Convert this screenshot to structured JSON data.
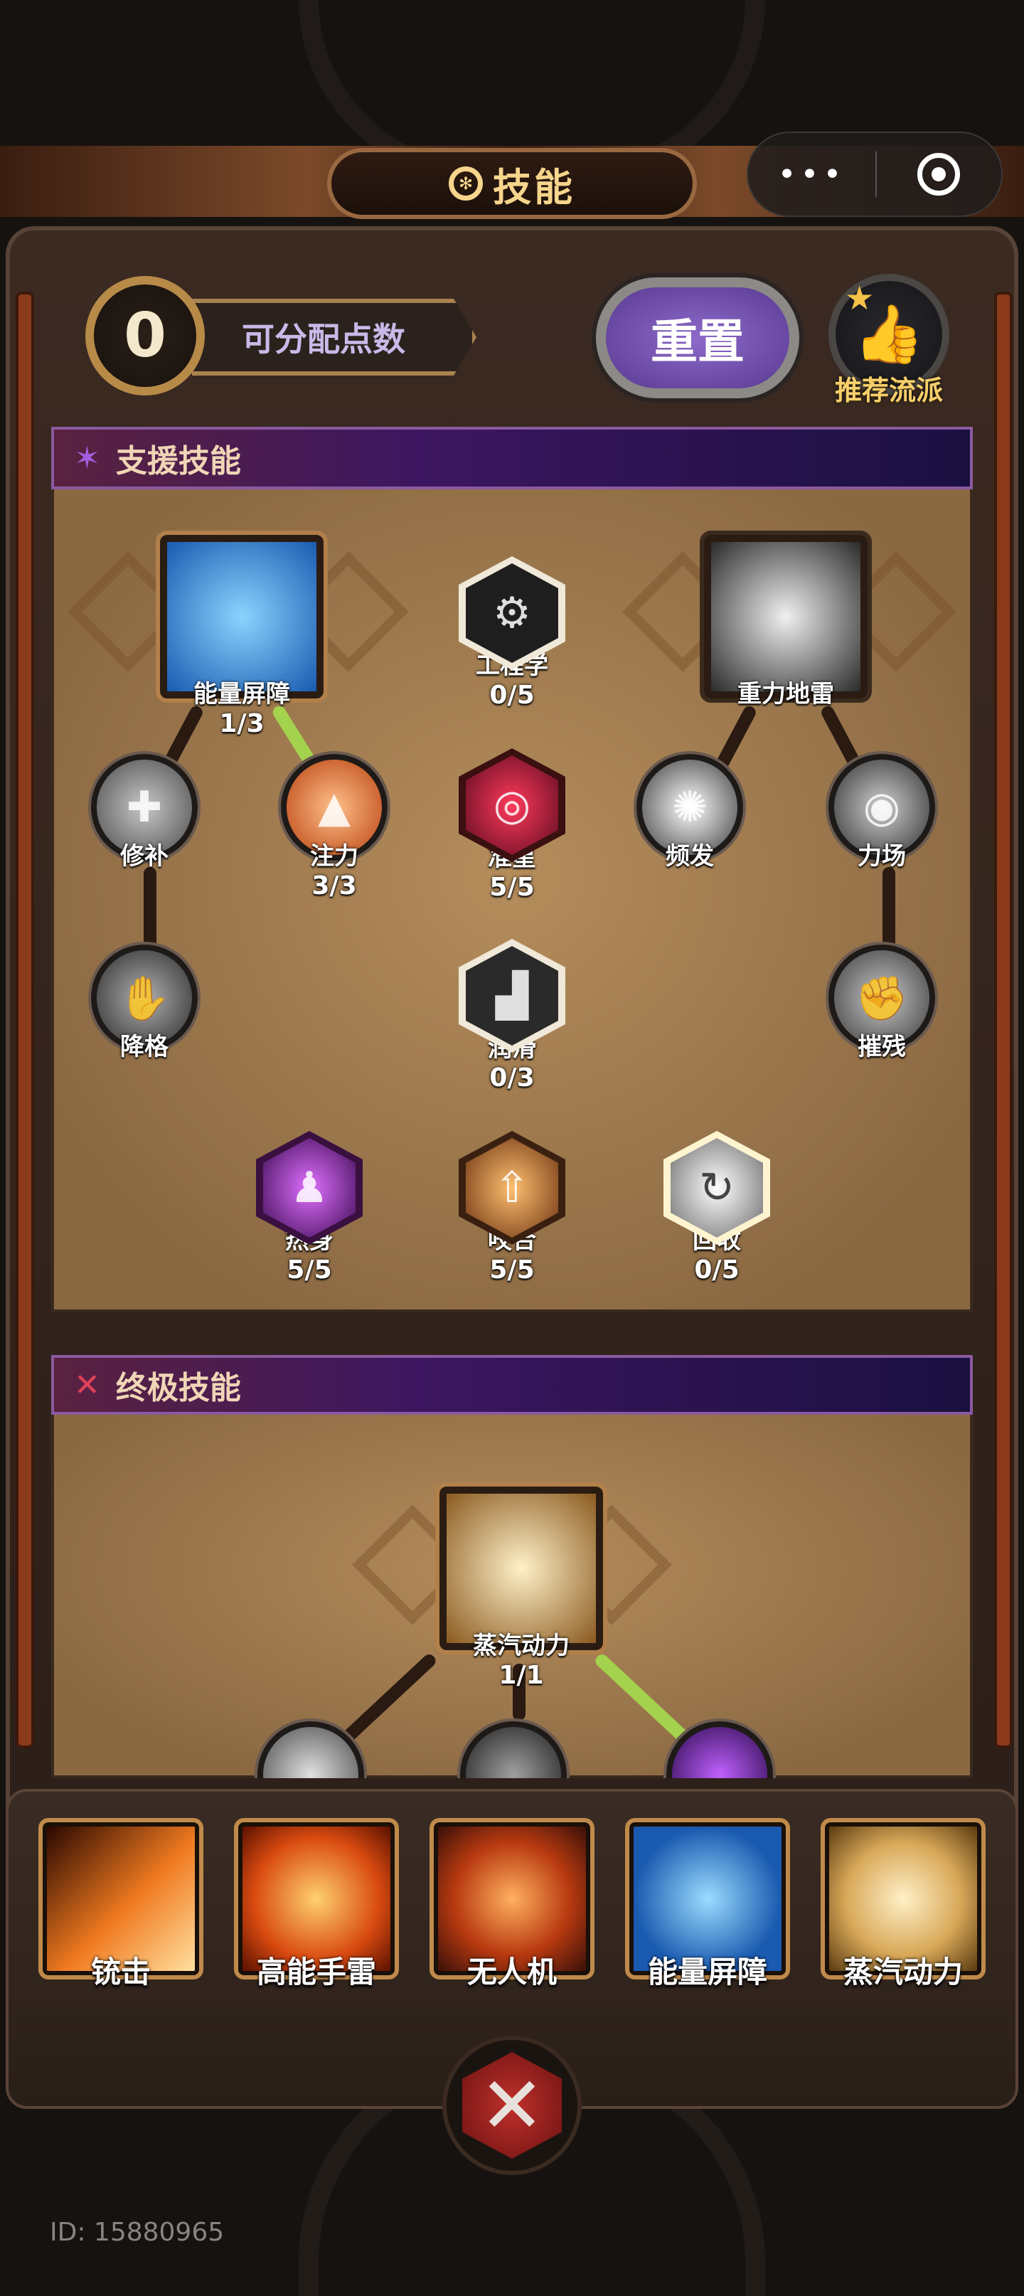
{
  "header": {
    "title": "技能",
    "more_icon": "•••",
    "target_icon": "target-icon"
  },
  "points": {
    "value": "0",
    "label": "可分配点数"
  },
  "reset_button": "重置",
  "recommend_button": "推荐流派",
  "sections": {
    "support": {
      "title": "支援技能"
    },
    "ultimate": {
      "title": "终极技能"
    }
  },
  "support_skills": [
    {
      "id": "energy-shield",
      "name": "能量屏障",
      "level": "1/3",
      "shape": "square",
      "color": "#3a8fe0"
    },
    {
      "id": "engineering",
      "name": "工程学",
      "level": "0/5",
      "shape": "hex",
      "color": "#2a2a2a"
    },
    {
      "id": "gravity-mine",
      "name": "重力地雷",
      "level": "",
      "shape": "square",
      "color": "#5a5a5a"
    },
    {
      "id": "repair",
      "name": "修补",
      "level": "",
      "shape": "circle",
      "color": "#8a8a8a"
    },
    {
      "id": "injection",
      "name": "注力",
      "level": "3/3",
      "shape": "circle",
      "color": "#e06a2a"
    },
    {
      "id": "aim",
      "name": "准星",
      "level": "5/5",
      "shape": "hex",
      "color": "#8a1a3a"
    },
    {
      "id": "burst",
      "name": "频发",
      "level": "",
      "shape": "circle",
      "color": "#9a9a9a"
    },
    {
      "id": "force-field",
      "name": "力场",
      "level": "",
      "shape": "circle",
      "color": "#6a6a6a"
    },
    {
      "id": "downgrade",
      "name": "降格",
      "level": "",
      "shape": "circle",
      "color": "#5a5a5a"
    },
    {
      "id": "lubricate",
      "name": "润滑",
      "level": "0/3",
      "shape": "hex",
      "color": "#3a3a3a"
    },
    {
      "id": "cripple",
      "name": "摧残",
      "level": "",
      "shape": "circle",
      "color": "#7a7a7a"
    },
    {
      "id": "warm-up",
      "name": "热身",
      "level": "5/5",
      "shape": "hex",
      "color": "#8a2aa0"
    },
    {
      "id": "bite",
      "name": "咬合",
      "level": "5/5",
      "shape": "hex",
      "color": "#b06a2a"
    },
    {
      "id": "recycle",
      "name": "回收",
      "level": "0/5",
      "shape": "hex",
      "color": "#c8c8c8"
    }
  ],
  "ultimate_skills": [
    {
      "id": "steam-power",
      "name": "蒸汽动力",
      "level": "1/1",
      "shape": "square",
      "color": "#d8a858"
    }
  ],
  "equipped": [
    {
      "name": "铳击",
      "color": "#f07a20"
    },
    {
      "name": "高能手雷",
      "color": "#d84a10"
    },
    {
      "name": "无人机",
      "color": "#b83a10"
    },
    {
      "name": "能量屏障",
      "color": "#3a8fe0"
    },
    {
      "name": "蒸汽动力",
      "color": "#d8a858"
    }
  ],
  "footer": {
    "id_text": "ID: 15880965"
  }
}
